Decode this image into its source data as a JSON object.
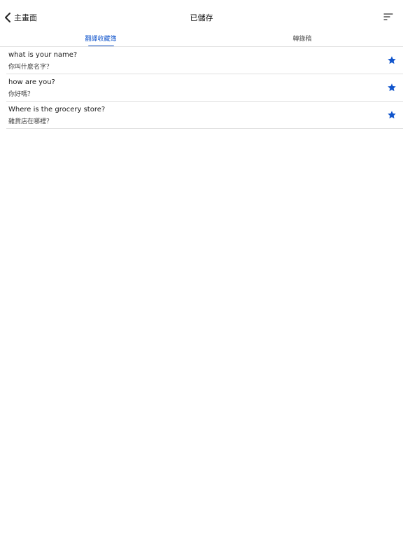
{
  "header": {
    "back_label": "主畫面",
    "title": "已儲存"
  },
  "tabs": [
    {
      "label": "翻譯收藏簿",
      "active": true
    },
    {
      "label": "轉錄稿",
      "active": false
    }
  ],
  "items": [
    {
      "source": "what is your name?",
      "translation": "你叫什麼名字？",
      "starred": true
    },
    {
      "source": "how are you?",
      "translation": "你好嗎？",
      "starred": true
    },
    {
      "source": "Where is the grocery store?",
      "translation": "雜貨店在哪裡？",
      "starred": true
    }
  ],
  "icons": {
    "back": "chevron-left-icon",
    "sort": "sort-icon",
    "star": "star-filled-icon"
  },
  "colors": {
    "accent": "#1a56c4",
    "star": "#1155cc",
    "divider": "#e0e0e0"
  }
}
